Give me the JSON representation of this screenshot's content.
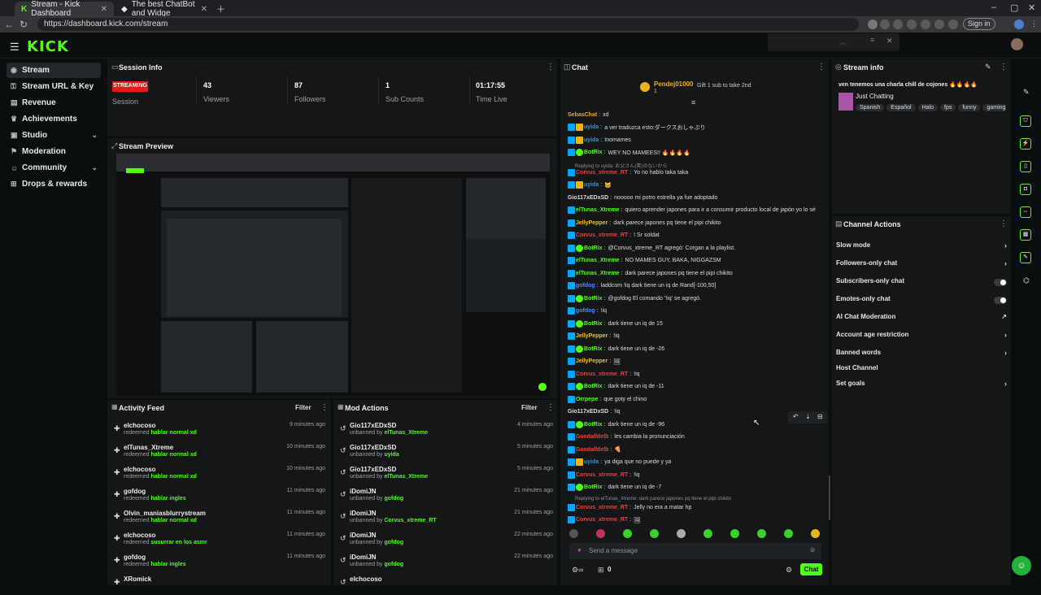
{
  "browser": {
    "tabs": [
      {
        "title": "Stream - Kick Dashboard"
      },
      {
        "title": "The best ChatBot and Widge"
      }
    ],
    "url": "https://dashboard.kick.com/stream",
    "signin": "Sign in"
  },
  "app": {
    "logo": "KICK"
  },
  "sidebar": {
    "items": [
      {
        "label": "Stream",
        "icon": "stream-icon"
      },
      {
        "label": "Stream URL & Key",
        "icon": "key-icon"
      },
      {
        "label": "Revenue",
        "icon": "revenue-icon"
      },
      {
        "label": "Achievements",
        "icon": "trophy-icon"
      },
      {
        "label": "Studio",
        "icon": "studio-icon"
      },
      {
        "label": "Moderation",
        "icon": "shield-icon"
      },
      {
        "label": "Community",
        "icon": "community-icon"
      },
      {
        "label": "Drops & rewards",
        "icon": "gift-icon"
      }
    ]
  },
  "session": {
    "title": "Session Info",
    "badge": "STREAMING",
    "session_label": "Session",
    "stats": [
      {
        "value": "43",
        "label": "Viewers"
      },
      {
        "value": "87",
        "label": "Followers"
      },
      {
        "value": "1",
        "label": "Sub Counts"
      },
      {
        "value": "01:17:55",
        "label": "Time Live"
      }
    ]
  },
  "preview": {
    "title": "Stream Preview"
  },
  "activity": {
    "title": "Activity Feed",
    "filter": "Filter",
    "rows": [
      {
        "name": "elchocoso",
        "action": "redeemed",
        "item": "hablar normal xd",
        "time": "9 minutes ago"
      },
      {
        "name": "elTunas_Xtreme",
        "action": "redeemed",
        "item": "hablar normal xd",
        "time": "10 minutes ago"
      },
      {
        "name": "elchocoso",
        "action": "redeemed",
        "item": "hablar normal xd",
        "time": "10 minutes ago"
      },
      {
        "name": "gofdog",
        "action": "redeemed",
        "item": "hablar ingles",
        "time": "11 minutes ago"
      },
      {
        "name": "Olvin_maniasblurrystream",
        "action": "redeemed",
        "item": "hablar normal xd",
        "time": "11 minutes ago"
      },
      {
        "name": "elchocoso",
        "action": "redeemed",
        "item": "susurrar en los asmr",
        "time": "11 minutes ago"
      },
      {
        "name": "gofdog",
        "action": "redeemed",
        "item": "hablar ingles",
        "time": "11 minutes ago"
      },
      {
        "name": "XRomick",
        "action": "",
        "item": "",
        "time": ""
      }
    ]
  },
  "mod_actions": {
    "title": "Mod Actions",
    "filter": "Filter",
    "rows": [
      {
        "name": "Gio117xEDxSD",
        "action": "unbanned by",
        "item": "elTunas_Xtreme",
        "time": "4 minutes ago"
      },
      {
        "name": "Gio117xEDxSD",
        "action": "unbanned by",
        "item": "uyida",
        "time": "5 minutes ago"
      },
      {
        "name": "Gio117xEDxSD",
        "action": "unbanned by",
        "item": "elTunas_Xtreme",
        "time": "5 minutes ago"
      },
      {
        "name": "iDomiJN",
        "action": "unbanned by",
        "item": "gofdog",
        "time": "21 minutes ago"
      },
      {
        "name": "iDomiJN",
        "action": "unbanned by",
        "item": "Corvus_xtreme_RT",
        "time": "21 minutes ago"
      },
      {
        "name": "iDomiJN",
        "action": "unbanned by",
        "item": "gofdog",
        "time": "22 minutes ago"
      },
      {
        "name": "iDomiJN",
        "action": "unbanned by",
        "item": "gofdog",
        "time": "22 minutes ago"
      },
      {
        "name": "elchocoso",
        "action": "",
        "item": "",
        "time": ""
      }
    ]
  },
  "chat": {
    "title": "Chat",
    "pinned_user": "Pendej01000",
    "pinned_count": "1",
    "pinned_text": "Gift 1 sub to take 2nd",
    "messages": [
      {
        "user": "SebasChat",
        "color": "#f2a33a",
        "badges": [],
        "text": "xd"
      },
      {
        "user": "uyida",
        "color": "#00a6ff",
        "badges": [
          "mod",
          "vip"
        ],
        "text": "a ver traduzca esto:ダークスおしゃぷり"
      },
      {
        "user": "uyida",
        "color": "#00a6ff",
        "badges": [
          "mod",
          "vip"
        ],
        "text": "Inomames"
      },
      {
        "user": "BotRix",
        "color": "#53fc18",
        "badges": [
          "mod",
          "bot"
        ],
        "text": "WEY NO MAMEES!! 🔥🔥🔥🔥"
      },
      {
        "reply": "Replying to uyida: お父さん(笑)のないから"
      },
      {
        "user": "Corvus_xtreme_RT",
        "color": "#e8443a",
        "badges": [
          "mod"
        ],
        "text": "Yo no hablo taka taka"
      },
      {
        "user": "uyida",
        "color": "#00a6ff",
        "badges": [
          "mod",
          "vip"
        ],
        "text": "🐱"
      },
      {
        "user": "Gio117xEDxSD",
        "color": "#dddddd",
        "badges": [],
        "text": "nooooo mi potro estrella ya fue adoptado"
      },
      {
        "user": "elTunas_Xtreme",
        "color": "#53fc18",
        "badges": [
          "mod"
        ],
        "text": "quiero aprender japones para ir a consumir producto local de japón yo lo sé"
      },
      {
        "user": "JellyPepper",
        "color": "#f2c31a",
        "badges": [
          "mod"
        ],
        "text": "dark parece japones pq tiene el pipi chikito"
      },
      {
        "user": "Corvus_xtreme_RT",
        "color": "#e8443a",
        "badges": [
          "mod"
        ],
        "text": "! Sr soldat"
      },
      {
        "user": "BotRix",
        "color": "#53fc18",
        "badges": [
          "mod",
          "bot"
        ],
        "text": "@Corvus_xtreme_RT agregó: Corgan a la playlist."
      },
      {
        "user": "elTunas_Xtreme",
        "color": "#53fc18",
        "badges": [
          "mod"
        ],
        "text": "NO MAMES GUY, BAKA, NIGGAZSM"
      },
      {
        "user": "elTunas_Xtreme",
        "color": "#53fc18",
        "badges": [
          "mod"
        ],
        "text": "dark parece japones pq tiene el pipi chikito"
      },
      {
        "user": "gofdog",
        "color": "#4a8cff",
        "badges": [
          "mod"
        ],
        "text": "laddcom !iq dark tiene un iq de Rand[-100,50]"
      },
      {
        "user": "BotRix",
        "color": "#53fc18",
        "badges": [
          "mod",
          "bot"
        ],
        "text": "@gofdog El comando '!iq' se agregó."
      },
      {
        "user": "gofdog",
        "color": "#4a8cff",
        "badges": [
          "mod"
        ],
        "text": "!iq"
      },
      {
        "user": "BotRix",
        "color": "#53fc18",
        "badges": [
          "mod",
          "bot"
        ],
        "text": "dark tiene un iq de 15"
      },
      {
        "user": "JellyPepper",
        "color": "#f2c31a",
        "badges": [
          "mod"
        ],
        "text": "!iq"
      },
      {
        "user": "BotRix",
        "color": "#53fc18",
        "badges": [
          "mod",
          "bot"
        ],
        "text": "dark tiene un iq de -26"
      },
      {
        "user": "JellyPepper",
        "color": "#f2c31a",
        "badges": [
          "mod"
        ],
        "text": "🖼"
      },
      {
        "user": "Corvus_xtreme_RT",
        "color": "#e8443a",
        "badges": [
          "mod"
        ],
        "text": "!iq"
      },
      {
        "user": "BotRix",
        "color": "#53fc18",
        "badges": [
          "mod",
          "bot"
        ],
        "text": "dark tiene un iq de -11"
      },
      {
        "user": "Orrpepe",
        "color": "#53fc18",
        "badges": [
          "mod"
        ],
        "text": "que goty el chino"
      },
      {
        "user": "Gio117xEDxSD",
        "color": "#dddddd",
        "badges": [],
        "text": "!iq"
      },
      {
        "user": "BotRix",
        "color": "#53fc18",
        "badges": [
          "mod",
          "bot"
        ],
        "text": "dark tiene un iq de -96"
      },
      {
        "user": "Gandalfdelb",
        "color": "#e8443a",
        "badges": [
          "mod"
        ],
        "text": "les cambia la pronunciación"
      },
      {
        "user": "Gandalfdelb",
        "color": "#e8443a",
        "badges": [
          "mod"
        ],
        "text": "🍕"
      },
      {
        "user": "uyida",
        "color": "#00a6ff",
        "badges": [
          "mod",
          "vip"
        ],
        "text": "ya diga que no puede y ya"
      },
      {
        "user": "Corvus_xtreme_RT",
        "color": "#e8443a",
        "badges": [
          "mod"
        ],
        "text": "!iq"
      },
      {
        "user": "BotRix",
        "color": "#53fc18",
        "badges": [
          "mod",
          "bot"
        ],
        "text": "dark tiene un iq de -7"
      },
      {
        "reply": "Replying to elTunas_Xtreme: dark parece japones pq tiene el pipi chikito"
      },
      {
        "user": "Corvus_xtreme_RT",
        "color": "#e8443a",
        "badges": [
          "mod"
        ],
        "text": "Jelly no era a matar hp"
      },
      {
        "user": "Corvus_xtreme_RT",
        "color": "#e8443a",
        "badges": [
          "mod"
        ],
        "text": "🖼"
      }
    ],
    "input_placeholder": "Send a message",
    "viewer_count": "0",
    "send_label": "Chat"
  },
  "stream_info": {
    "title": "Stream info",
    "stream_title": "ven tenemos una charla chill de cojones 🔥🔥🔥🔥",
    "category": "Just Chatting",
    "tags": [
      "Spanish",
      "Español",
      "Halo",
      "fps",
      "funny",
      "gaming"
    ]
  },
  "channel_actions": {
    "title": "Channel Actions",
    "rows": [
      {
        "label": "Slow mode",
        "control": "chevron"
      },
      {
        "label": "Followers-only chat",
        "control": "chevron"
      },
      {
        "label": "Subscribers-only chat",
        "control": "toggle"
      },
      {
        "label": "Emotes-only chat",
        "control": "toggle"
      },
      {
        "label": "AI Chat Moderation",
        "control": "external"
      },
      {
        "label": "Account age restriction",
        "control": "chevron"
      },
      {
        "label": "Banned words",
        "control": "chevron"
      },
      {
        "label": "Host Channel",
        "control": "none"
      },
      {
        "label": "Set goals",
        "control": "chevron"
      }
    ]
  }
}
